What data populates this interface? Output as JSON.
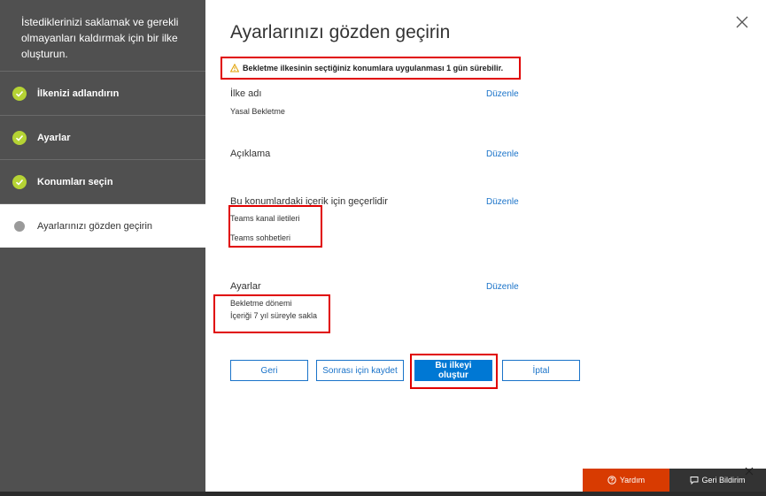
{
  "sidebar": {
    "header": "İstediklerinizi saklamak ve gerekli olmayanları kaldırmak için bir ilke oluşturun.",
    "steps": [
      {
        "label": "İlkenizi adlandırın",
        "state": "done"
      },
      {
        "label": "Ayarlar",
        "state": "done"
      },
      {
        "label": "Konumları seçin",
        "state": "done"
      },
      {
        "label": "Ayarlarınızı gözden geçirin",
        "state": "current"
      }
    ]
  },
  "main": {
    "title": "Ayarlarınızı gözden geçirin",
    "warning": "Bekletme ilkesinin seçtiğiniz konumlara uygulanması 1 gün sürebilir.",
    "edit_label": "Düzenle",
    "sections": {
      "policy_name": {
        "title": "İlke adı",
        "value": "Yasal Bekletme"
      },
      "description": {
        "title": "Açıklama"
      },
      "locations": {
        "title": "Bu konumlardaki içerik için geçerlidir",
        "values": [
          "Teams kanal iletileri",
          "Teams sohbetleri"
        ]
      },
      "settings": {
        "title": "Ayarlar",
        "values": [
          "Bekletme dönemi",
          "İçeriği 7 yıl süreyle sakla"
        ]
      }
    },
    "buttons": {
      "back": "Geri",
      "save_later": "Sonrası için kaydet",
      "create": "Bu ilkeyi oluştur",
      "cancel": "İptal"
    }
  },
  "footer": {
    "help": "Yardım",
    "feedback": "Geri Bildirim"
  },
  "colors": {
    "sidebar_bg": "#505050",
    "check_green": "#b5d334",
    "link_blue": "#1a73c9",
    "primary_blue": "#0078d4",
    "highlight_red": "#e00000",
    "help_orange": "#d83b01"
  }
}
